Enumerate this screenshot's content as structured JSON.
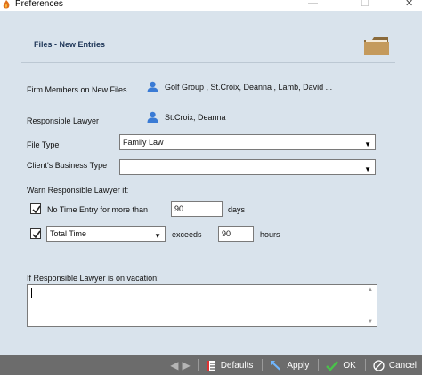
{
  "window": {
    "title": "Preferences",
    "minimize": "—",
    "maximize": "☐",
    "close": "✕"
  },
  "header": {
    "section_title": "Files - New Entries"
  },
  "firm_members": {
    "label": "Firm Members on New Files",
    "value": "Golf Group  , St.Croix, Deanna  , Lamb, David  ..."
  },
  "responsible_lawyer": {
    "label": "Responsible Lawyer",
    "value": "St.Croix, Deanna"
  },
  "file_type": {
    "label": "File Type",
    "value": "Family Law"
  },
  "business_type": {
    "label": "Client's Business Type",
    "value": ""
  },
  "warn": {
    "label": "Warn Responsible Lawyer if:",
    "no_time_entry": {
      "checked": true,
      "label": "No Time Entry for more than",
      "value": "90",
      "unit": "days"
    },
    "total_time": {
      "checked": true,
      "select_value": "Total Time",
      "connector": "exceeds",
      "value": "90",
      "unit": "hours"
    }
  },
  "vacation": {
    "label": "If Responsible Lawyer is on vacation:",
    "value": ""
  },
  "footer": {
    "defaults": "Defaults",
    "apply": "Apply",
    "ok": "OK",
    "cancel": "Cancel"
  },
  "colors": {
    "content_bg": "#d9e3ec",
    "footer_bg": "#6c6c6c",
    "accent_blue": "#3a7bd5",
    "folder": "#b8915a"
  },
  "icons": [
    "app-icon",
    "folder-icon",
    "person-icon",
    "check-icon",
    "arrow-left-icon",
    "arrow-right-icon",
    "calendar-icon",
    "apply-icon",
    "ok-check-icon",
    "cancel-icon"
  ]
}
